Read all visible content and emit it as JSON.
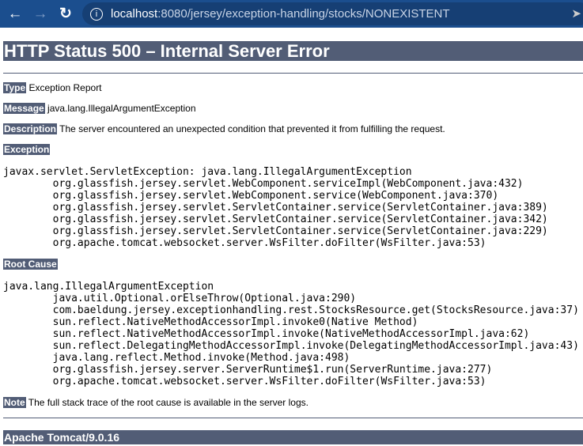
{
  "browser": {
    "url_host": "localhost",
    "url_path": ":8080/jersey/exception-handling/stocks/NONEXISTENT"
  },
  "title": "HTTP Status 500 – Internal Server Error",
  "type": {
    "label": "Type",
    "value": "Exception Report"
  },
  "message": {
    "label": "Message",
    "value": "java.lang.IllegalArgumentException"
  },
  "description": {
    "label": "Description",
    "value": "The server encountered an unexpected condition that prevented it from fulfilling the request."
  },
  "exception": {
    "label": "Exception",
    "trace": "javax.servlet.ServletException: java.lang.IllegalArgumentException\n\torg.glassfish.jersey.servlet.WebComponent.serviceImpl(WebComponent.java:432)\n\torg.glassfish.jersey.servlet.WebComponent.service(WebComponent.java:370)\n\torg.glassfish.jersey.servlet.ServletContainer.service(ServletContainer.java:389)\n\torg.glassfish.jersey.servlet.ServletContainer.service(ServletContainer.java:342)\n\torg.glassfish.jersey.servlet.ServletContainer.service(ServletContainer.java:229)\n\torg.apache.tomcat.websocket.server.WsFilter.doFilter(WsFilter.java:53)"
  },
  "root_cause": {
    "label": "Root Cause",
    "trace": "java.lang.IllegalArgumentException\n\tjava.util.Optional.orElseThrow(Optional.java:290)\n\tcom.baeldung.jersey.exceptionhandling.rest.StocksResource.get(StocksResource.java:37)\n\tsun.reflect.NativeMethodAccessorImpl.invoke0(Native Method)\n\tsun.reflect.NativeMethodAccessorImpl.invoke(NativeMethodAccessorImpl.java:62)\n\tsun.reflect.DelegatingMethodAccessorImpl.invoke(DelegatingMethodAccessorImpl.java:43)\n\tjava.lang.reflect.Method.invoke(Method.java:498)\n\torg.glassfish.jersey.server.ServerRuntime$1.run(ServerRuntime.java:277)\n\torg.apache.tomcat.websocket.server.WsFilter.doFilter(WsFilter.java:53)"
  },
  "note": {
    "label": "Note",
    "value": "The full stack trace of the root cause is available in the server logs."
  },
  "footer": "Apache Tomcat/9.0.16"
}
